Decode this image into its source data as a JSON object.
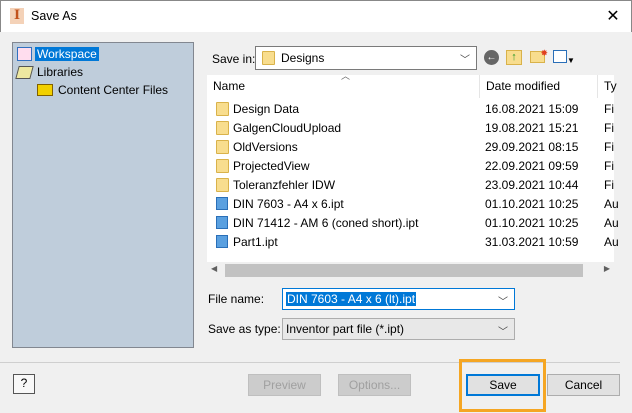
{
  "window": {
    "title": "Save As",
    "close": "✕"
  },
  "left_panel": {
    "items": [
      {
        "label": "Workspace",
        "selected": true
      },
      {
        "label": "Libraries"
      },
      {
        "label": "Content Center Files"
      }
    ]
  },
  "save_in": {
    "label": "Save in:",
    "value": "Designs"
  },
  "columns": [
    "Name",
    "Date modified",
    "Ty"
  ],
  "files": [
    {
      "name": "Design Data",
      "date": "16.08.2021 15:09",
      "type": "Fi",
      "kind": "folder"
    },
    {
      "name": "GalgenCloudUpload",
      "date": "19.08.2021 15:21",
      "type": "Fi",
      "kind": "folder"
    },
    {
      "name": "OldVersions",
      "date": "29.09.2021 08:15",
      "type": "Fi",
      "kind": "folder"
    },
    {
      "name": "ProjectedView",
      "date": "22.09.2021 09:59",
      "type": "Fi",
      "kind": "folder"
    },
    {
      "name": "Toleranzfehler IDW",
      "date": "23.09.2021 10:44",
      "type": "Fi",
      "kind": "folder"
    },
    {
      "name": "DIN 7603 - A4 x 6.ipt",
      "date": "01.10.2021 10:25",
      "type": "Au",
      "kind": "part"
    },
    {
      "name": "DIN 71412 - AM 6 (coned short).ipt",
      "date": "01.10.2021 10:25",
      "type": "Au",
      "kind": "part"
    },
    {
      "name": "Part1.ipt",
      "date": "31.03.2021 10:59",
      "type": "Au",
      "kind": "part"
    }
  ],
  "file_name": {
    "label": "File name:",
    "value": "DIN 7603 - A4 x 6  (lt).ipt"
  },
  "save_type": {
    "label": "Save as type:",
    "value": "Inventor part file (*.ipt)"
  },
  "buttons": {
    "help": "?",
    "preview": "Preview",
    "options": "Options...",
    "save": "Save",
    "cancel": "Cancel"
  },
  "colors": {
    "highlight": "#f5a623",
    "selection": "#0078d7"
  }
}
